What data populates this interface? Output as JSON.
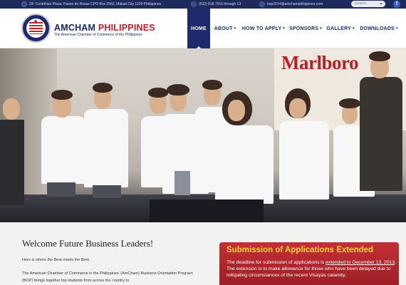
{
  "topbar": {
    "address": "2/F Corinthian Plaza, Paseo de Roxas CPO Box 2562, Makati City 1229 Philippines",
    "phone": "(632) 818-7911 through 13",
    "email": "bop2014@amchamphilippines.com",
    "search_placeholder": "Search...",
    "facebook_label": "f"
  },
  "brand": {
    "name_part1": "AMCHAM",
    "name_part2": "PHILIPPINES",
    "tagline": "The American Chamber of Commerce of the Philippines"
  },
  "nav": {
    "items": [
      {
        "label": "HOME",
        "active": true
      },
      {
        "label": "ABOUT",
        "caret": "▾"
      },
      {
        "label": "HOW TO APPLY",
        "caret": "▾"
      },
      {
        "label": "SPONSORS",
        "caret": "▾"
      },
      {
        "label": "GALLERY",
        "caret": "▾"
      },
      {
        "label": "DOWNLOADS",
        "caret": "▾"
      }
    ]
  },
  "hero": {
    "banner_text": "Marlboro"
  },
  "content": {
    "welcome_title": "Welcome Future Business Leaders!",
    "intro": "Here is where the Best meets the Best.",
    "body": "The American Chamber of Commerce in the Philippines' (AmCham) Business Orientation Program (BOP) brings together top students from across the country to"
  },
  "notice": {
    "title": "Submission of Applications Extended",
    "body_pre": "The deadline for submission of applications is ",
    "body_link": "extended to December 13, 2013",
    "body_post": ". The extension is to make allowance for those who have been delayed due to mitigating circumstances of the recent Visayas calamity."
  },
  "colors": {
    "navy": "#1e2a6b",
    "brand_red": "#c01f2a",
    "notice_red": "#b3292f",
    "notice_title": "#ffd52e"
  }
}
